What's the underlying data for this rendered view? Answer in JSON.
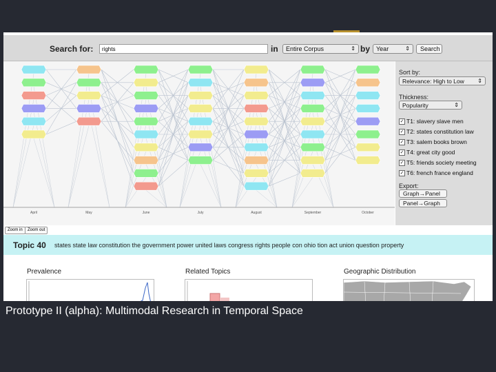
{
  "search": {
    "label": "Search for:",
    "query": "rights",
    "in_label": "in",
    "corpus": "Entire Corpus",
    "by_label": "by",
    "by_value": "Year",
    "button": "Search"
  },
  "graph": {
    "months": [
      "April",
      "May",
      "June",
      "July",
      "August",
      "September",
      "October"
    ],
    "zoom_in": "Zoom in",
    "zoom_out": "Zoom out"
  },
  "sidebar": {
    "sort_label": "Sort by:",
    "sort_value": "Relevance: High to Low",
    "thickness_label": "Thickness:",
    "thickness_value": "Popularity",
    "topics": [
      "T1: slavery slave men",
      "T2: states constitution law",
      "T3: salem books brown",
      "T4: great city good",
      "T5: friends society meeting",
      "T6: french france england"
    ],
    "export_label": "Export:",
    "export_buttons": [
      "Graph→Panel",
      "Panel→Graph"
    ]
  },
  "topic": {
    "title": "Topic 40",
    "words": "states state law constitution the government power united laws congress rights people con ohio tion act union question property"
  },
  "sections": {
    "prevalence": "Prevalence",
    "related": "Related Topics",
    "geo": "Geographic Distribution"
  },
  "caption": "Prototype II (alpha): Multimodal Research in Temporal Space",
  "colors": {
    "cyan": "#8fe6f2",
    "green": "#8ef08e",
    "salmon": "#f39a8e",
    "purple": "#9c9cf4",
    "yellow": "#f2ec8e",
    "orange": "#f6c48c",
    "topic_bar": "#c6f2f4",
    "background": "#262932"
  }
}
